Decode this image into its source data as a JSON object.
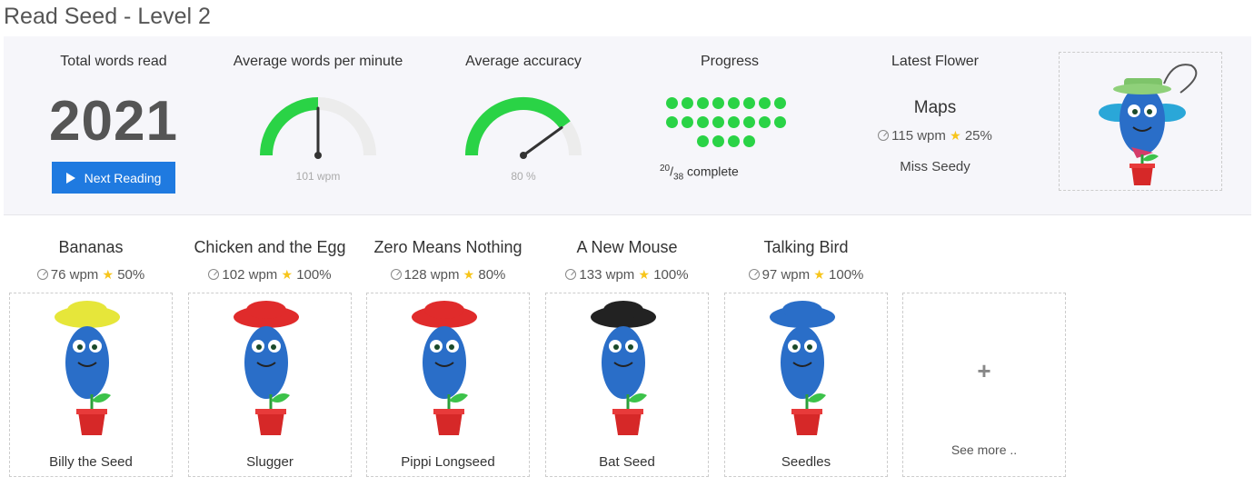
{
  "page": {
    "title": "Read Seed - Level 2"
  },
  "stats": {
    "total_words": {
      "label": "Total words read",
      "value": "2021"
    },
    "next_button": {
      "label": "Next Reading",
      "icon": "play-icon"
    },
    "wpm": {
      "label": "Average words per minute",
      "caption": "101 wpm",
      "level": 0.5
    },
    "accuracy": {
      "label": "Average accuracy",
      "caption": "80 %",
      "level": 0.8
    },
    "progress": {
      "label": "Progress",
      "done": "20",
      "total": "38",
      "suffix": "complete"
    },
    "latest": {
      "label": "Latest Flower",
      "name": "Maps",
      "wpm": "115 wpm",
      "score": "25%",
      "seed": "Miss Seedy"
    }
  },
  "colors": {
    "accent_green": "#2ad346",
    "button_blue": "#1f7ae0",
    "star_yellow": "#f7c51b",
    "panel_bg": "#f6f6fa"
  },
  "flowers": [
    {
      "title": "Bananas",
      "wpm": "76 wpm",
      "score": "50%",
      "seed": "Billy the Seed"
    },
    {
      "title": "Chicken and the Egg",
      "wpm": "102 wpm",
      "score": "100%",
      "seed": "Slugger"
    },
    {
      "title": "Zero Means Nothing",
      "wpm": "128 wpm",
      "score": "80%",
      "seed": "Pippi Longseed"
    },
    {
      "title": "A New Mouse",
      "wpm": "133 wpm",
      "score": "100%",
      "seed": "Bat Seed"
    },
    {
      "title": "Talking Bird",
      "wpm": "97 wpm",
      "score": "100%",
      "seed": "Seedles"
    }
  ],
  "see_more": {
    "label": "See more ..",
    "icon": "plus-icon"
  }
}
